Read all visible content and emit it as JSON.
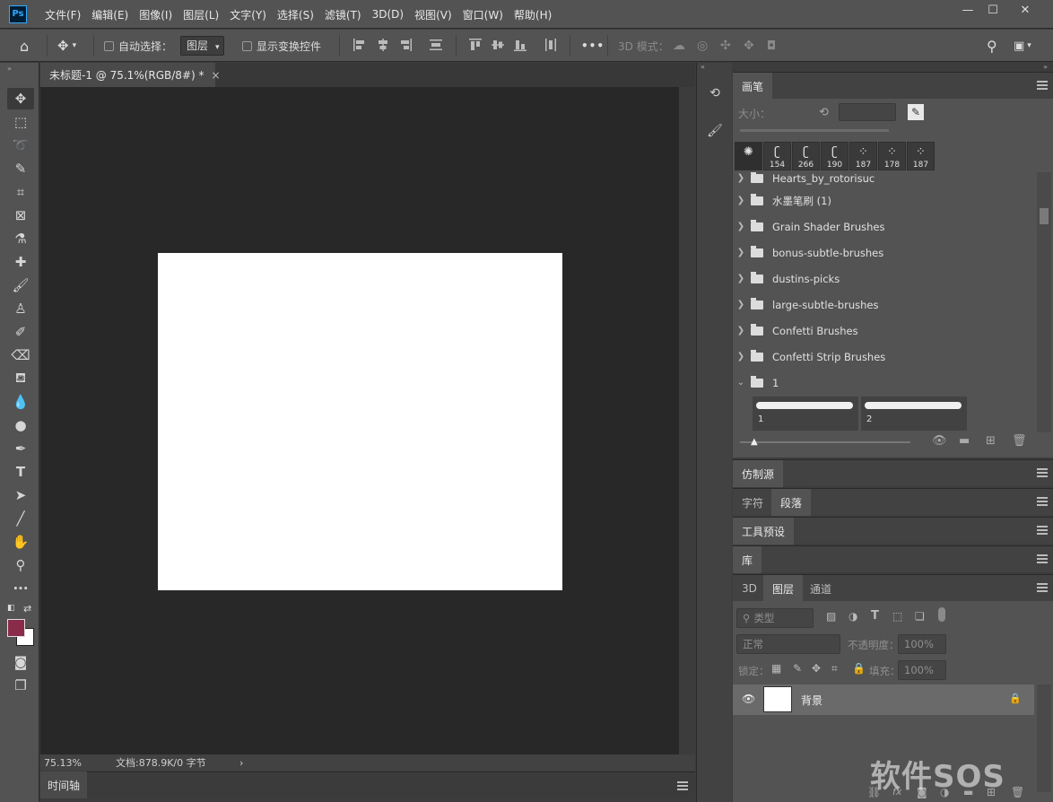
{
  "app": {
    "logo_text": "Ps"
  },
  "menu": [
    "文件(F)",
    "编辑(E)",
    "图像(I)",
    "图层(L)",
    "文字(Y)",
    "选择(S)",
    "滤镜(T)",
    "3D(D)",
    "视图(V)",
    "窗口(W)",
    "帮助(H)"
  ],
  "window_controls": {
    "minimize": "—",
    "maximize": "☐",
    "close": "✕"
  },
  "options": {
    "auto_select_label": "自动选择：",
    "auto_select_value": "图层",
    "show_transform_label": "显示变换控件",
    "more": "•••",
    "mode_3d_label": "3D 模式："
  },
  "document": {
    "tab_title": "未标题-1 @ 75.1%(RGB/8#) *",
    "tab_close": "×",
    "zoom": "75.13%",
    "doc_info": "文档:878.9K/0 字节",
    "status_arrow": "›"
  },
  "timeline": {
    "label": "时间轴"
  },
  "brush_panel": {
    "tab": "画笔",
    "size_label": "大小：",
    "recent_brushes": [
      {
        "size": "",
        "mark": "✺"
      },
      {
        "size": "154",
        "mark": "ʗ"
      },
      {
        "size": "266",
        "mark": "ʗ"
      },
      {
        "size": "190",
        "mark": "ʗ"
      },
      {
        "size": "187",
        "mark": "⁘"
      },
      {
        "size": "178",
        "mark": "⁘"
      },
      {
        "size": "187",
        "mark": "⁘"
      }
    ],
    "folders": [
      "Hearts_by_rotorisuc",
      "水墨笔刷 (1)",
      "Grain Shader Brushes",
      "bonus-subtle-brushes",
      "dustins-picks",
      "large-subtle-brushes",
      "Confetti Brushes",
      "Confetti Strip Brushes"
    ],
    "open_folder": "1",
    "strokes": [
      "1",
      "2"
    ]
  },
  "panels": {
    "clone_source": "仿制源",
    "character": "字符",
    "paragraph": "段落",
    "tool_presets": "工具预设",
    "libraries": "库"
  },
  "layers_panel": {
    "tabs": [
      "3D",
      "图层",
      "通道"
    ],
    "filter_placeholder": "类型",
    "blend_mode": "正常",
    "opacity_label": "不透明度：",
    "opacity_value": "100%",
    "lock_label": "锁定：",
    "fill_label": "填充：",
    "fill_value": "100%",
    "layers": [
      {
        "name": "背景",
        "visible": true,
        "locked": true
      }
    ]
  },
  "watermark": "软件SOS",
  "colors": {
    "foreground": "#8a2b4a",
    "background": "#ffffff",
    "ui_dark": "#282828",
    "ui_panel": "#535353"
  }
}
